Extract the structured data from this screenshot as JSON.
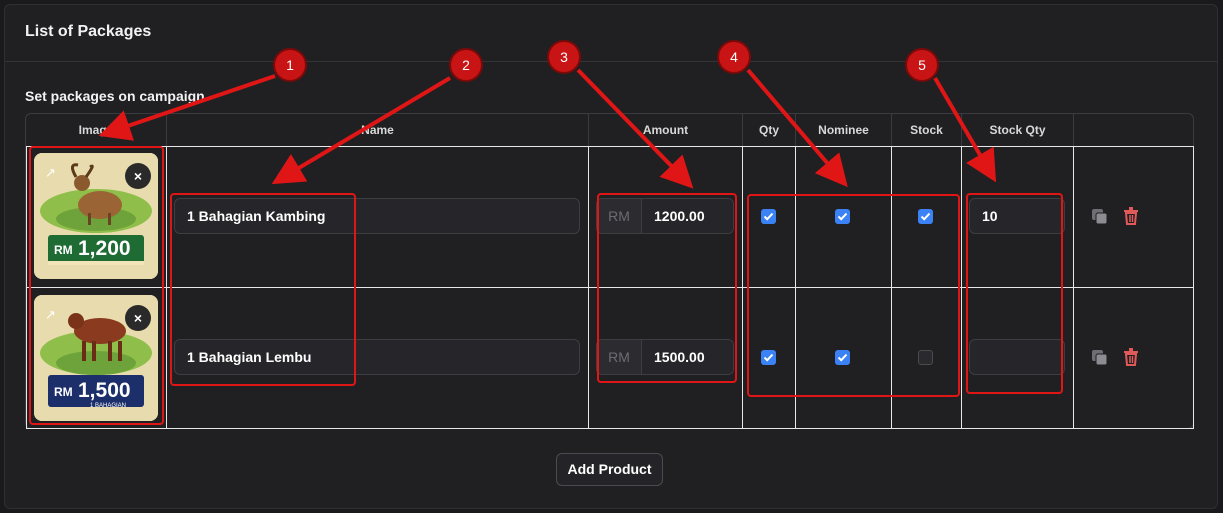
{
  "card": {
    "title": "List of Packages",
    "section_label": "Set packages on campaign"
  },
  "columns": [
    "Image",
    "Name",
    "Amount",
    "Qty",
    "Nominee",
    "Stock",
    "Stock Qty"
  ],
  "rows": [
    {
      "thumb_price": "RM 1,200",
      "name": "1 Bahagian Kambing",
      "currency": "RM",
      "amount": "1200.00",
      "qty": true,
      "nominee": true,
      "stock": true,
      "stock_qty": "10"
    },
    {
      "thumb_price": "RM 1,500",
      "name": "1 Bahagian Lembu",
      "currency": "RM",
      "amount": "1500.00",
      "qty": true,
      "nominee": true,
      "stock": false,
      "stock_qty": ""
    }
  ],
  "thumb_caption": "1 BAHAGIAN",
  "add_button": "Add Product",
  "annotations": [
    "1",
    "2",
    "3",
    "4",
    "5"
  ],
  "colors": {
    "annotation": "#e01616",
    "checkbox": "#3b82f6",
    "delete": "#e05a5a"
  }
}
